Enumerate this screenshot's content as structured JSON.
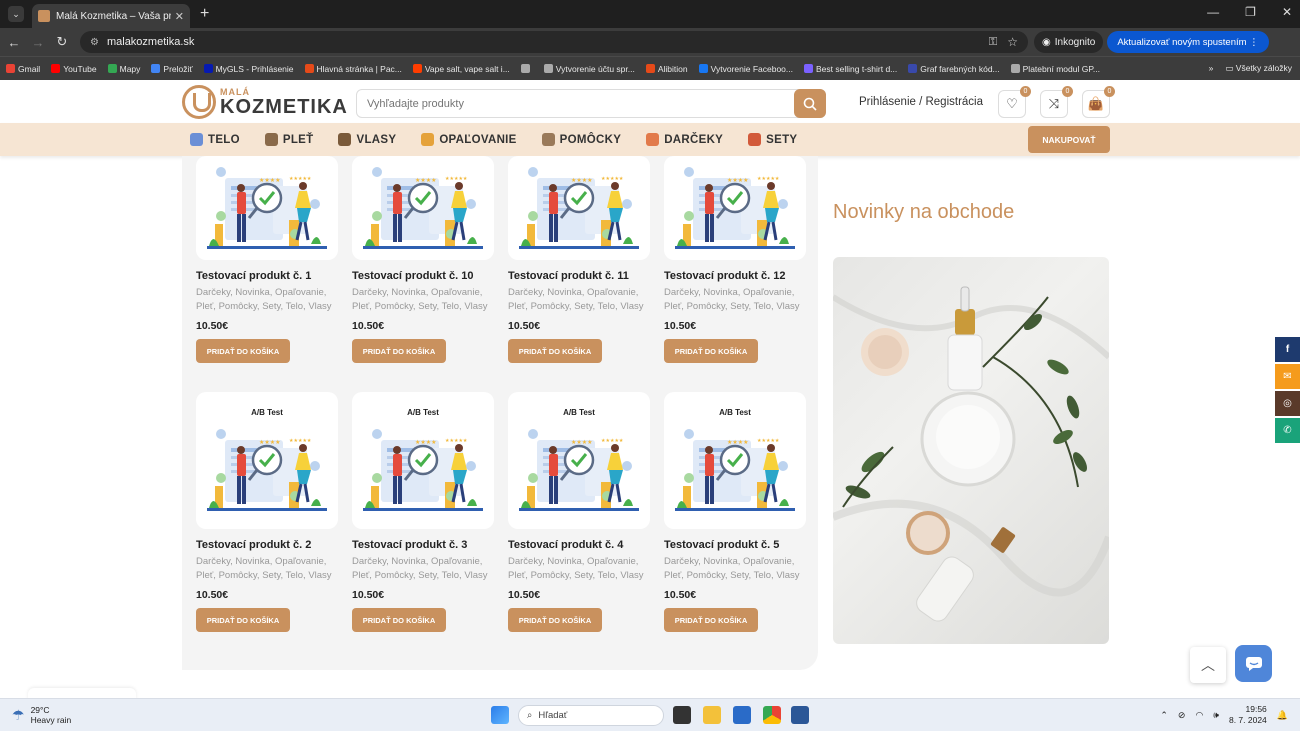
{
  "browser": {
    "tab_title": "Malá Kozmetika – Vaša prírodná",
    "url": "malakozmetika.sk",
    "incognito_label": "Inkognito",
    "update_label": "Aktualizovať novým spustením",
    "bookmarks": [
      {
        "label": "Gmail",
        "color": "#ea4335"
      },
      {
        "label": "YouTube",
        "color": "#ff0000"
      },
      {
        "label": "Mapy",
        "color": "#34a853"
      },
      {
        "label": "Preložiť",
        "color": "#4285f4"
      },
      {
        "label": "MyGLS - Prihlásenie",
        "color": "#061ab1"
      },
      {
        "label": "Hlavná stránka | Pac...",
        "color": "#e64a19"
      },
      {
        "label": "Vape salt, vape salt i...",
        "color": "#ff3d00"
      },
      {
        "label": "",
        "color": "#aaaaaa"
      },
      {
        "label": "Vytvorenie účtu spr...",
        "color": "#aaaaaa"
      },
      {
        "label": "Alibition",
        "color": "#e64a19"
      },
      {
        "label": "Vytvorenie Faceboo...",
        "color": "#1877f2"
      },
      {
        "label": "Best selling t-shirt d...",
        "color": "#7b61ff"
      },
      {
        "label": "Graf farebných kód...",
        "color": "#3949ab"
      },
      {
        "label": "Platební modul GP...",
        "color": "#aaaaaa"
      }
    ],
    "all_bookmarks_label": "Všetky záložky"
  },
  "header": {
    "logo_small": "MALÁ",
    "logo_big": "KOZMETIKA",
    "search_placeholder": "Vyhľadajte produkty",
    "login_label": "Prihlásenie / Registrácia",
    "wishlist_count": "0",
    "compare_count": "0",
    "cart_count": "0"
  },
  "nav": {
    "items": [
      {
        "label": "TELO",
        "color": "#6b8fd6"
      },
      {
        "label": "PLEŤ",
        "color": "#8a6a4a"
      },
      {
        "label": "VLASY",
        "color": "#7a5a3a"
      },
      {
        "label": "OPAĽOVANIE",
        "color": "#e5a23a"
      },
      {
        "label": "POMÔCKY",
        "color": "#9a7a5a"
      },
      {
        "label": "DARČEKY",
        "color": "#e27a4a"
      },
      {
        "label": "SETY",
        "color": "#d25a3a"
      }
    ],
    "cta_label": "NAKUPOVAŤ"
  },
  "products": {
    "categories_text": "Darčeky, Novinka, Opaľovanie, Pleť, Pomôcky, Sety, Telo, Vlasy",
    "price": "10.50€",
    "button_label": "PRIDAŤ DO KOŠÍKA",
    "ab_label": "A/B Test",
    "row1": [
      {
        "title": "Testovací produkt č. 1"
      },
      {
        "title": "Testovací produkt č. 10"
      },
      {
        "title": "Testovací produkt č. 11"
      },
      {
        "title": "Testovací produkt č. 12"
      }
    ],
    "row2": [
      {
        "title": "Testovací produkt č. 2"
      },
      {
        "title": "Testovací produkt č. 3"
      },
      {
        "title": "Testovací produkt č. 4"
      },
      {
        "title": "Testovací produkt č. 5"
      }
    ]
  },
  "sidebar": {
    "title": "Novinky na obchode"
  },
  "social": {
    "icons": [
      "facebook-icon",
      "email-icon",
      "instagram-icon",
      "whatsapp-icon"
    ],
    "labels": [
      "f",
      "✉",
      "◎",
      "✆"
    ],
    "colors": [
      "#1e3a6e",
      "#f59b1c",
      "#5a3a2a",
      "#1aa37a"
    ]
  },
  "taskbar": {
    "temperature": "29°C",
    "weather": "Heavy rain",
    "search_label": "Hľadať",
    "time": "19:56",
    "date": "8. 7. 2024"
  }
}
